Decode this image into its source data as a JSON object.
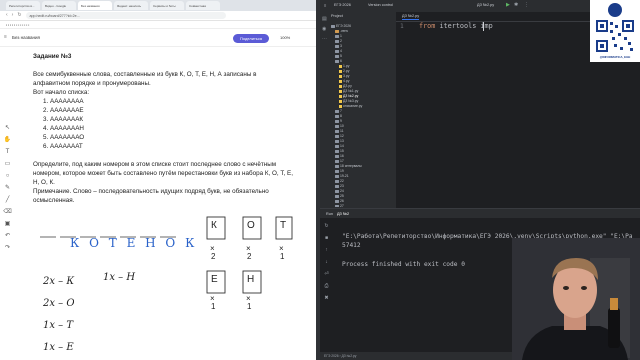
{
  "browser": {
    "tabs": [
      "Репетиторство в...",
      "Видео - Google",
      "Без названия",
      "Яндекс: нашлось",
      "Сервисы и боты",
      "Совместная"
    ],
    "url": "app.hedit.ru/board/277?id=2e..."
  },
  "whiteboard": {
    "title": "Без названия",
    "share_label": "Поделиться",
    "zoom": "100%"
  },
  "task": {
    "heading": "Задание №3",
    "intro": "Все семибуквенные слова, составленные из букв К, О, Т, Е, Н, А записаны в алфавитном порядке и пронумерованы.",
    "list_intro": "Вот начало списка:",
    "list": [
      "1.  АААААААА",
      "2.  АААААААЕ",
      "3.  АААААААК",
      "4.  АААААААН",
      "5.  АААААААО",
      "6.  АААААААТ"
    ],
    "question": "Определите, под каким номером в этом списке стоит последнее слово с нечётным номером, которое может быть составлено путём перестановки букв из набора К, О, Т, Е, Н, О, К.",
    "note": "Примечание. Слово – последовательность идущих подряд букв, не обязательно осмысленная."
  },
  "handwriting": {
    "word": "К О Т Е Н О К",
    "letters": [
      "К",
      "О",
      "Т",
      "Е",
      "Н"
    ],
    "counts_top": [
      "2",
      "2",
      "1"
    ],
    "counts_bottom": [
      "1",
      "1"
    ],
    "lines": [
      "2x – К",
      "2x – О",
      "1x – Т",
      "1x – Е"
    ],
    "side": "1x – Н"
  },
  "ide": {
    "project_name": "ЕГЭ 2026",
    "version_control": "Version control",
    "file_tab": "ДЗ №2.py",
    "project_label": "Project",
    "line_number": "1",
    "code_keyword": "from",
    "code_rest": " itertools imp",
    "run_label": "Run",
    "run_tab": "ДЗ №2",
    "console_path": "\"E:\\Работа\\Репетиторство\\Информатика\\ЕГЭ 2026\\.venv\\Scripts\\python.exe\" \"E:\\Работа\\Р",
    "console_result": "57412",
    "console_exit": "Process finished with exit code 0",
    "status": "ЕГЭ 2026 › ДЗ №2.py",
    "tree": [
      "ЕГЭ 2026",
      ".venv",
      "1",
      "2",
      "3",
      "4",
      "5",
      "6",
      "1.py",
      "2.py",
      "3.py",
      "4.py",
      "ДЗ.py",
      "ДЗ №1.py",
      "ДЗ №2.py",
      "ДЗ №3.py",
      "описание.py",
      "7",
      "8",
      "9",
      "10",
      "11",
      "12",
      "13",
      "14",
      "15",
      "16",
      "17",
      "18 интервалы",
      "19",
      "19-21",
      "22",
      "23",
      "24",
      "25",
      "26",
      "27",
      "test",
      "КЕГЭ 2023",
      "ЕГКР 2025",
      "Разбор 17052026"
    ]
  },
  "qr": {
    "caption": "@INFORMATICA_EGE"
  },
  "colors": {
    "ide_bg": "#1e1f22",
    "ide_panel": "#2b2d30",
    "accent": "#5b5bd6",
    "keyword": "#cf8e6d"
  }
}
